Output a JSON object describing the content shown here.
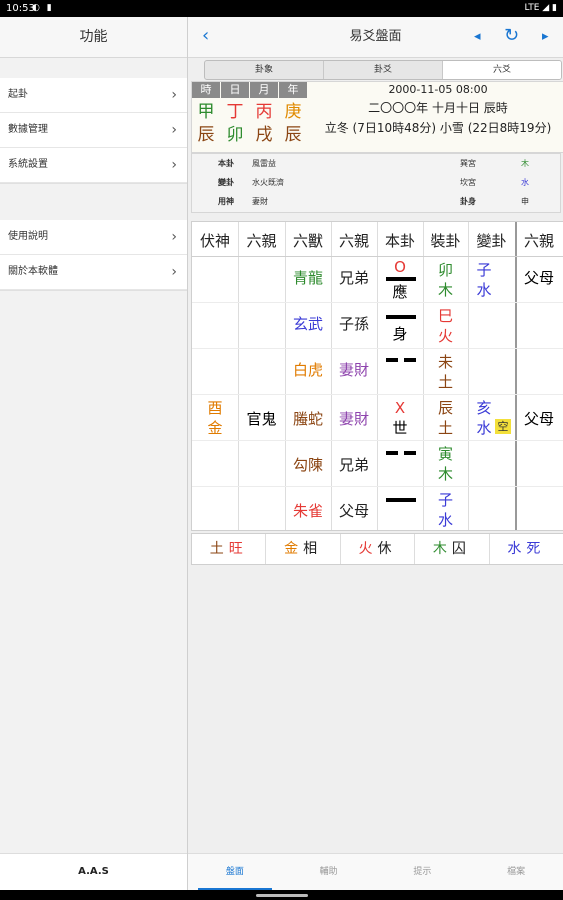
{
  "status": {
    "time": "10:53",
    "icons": "◐ ▮",
    "right": "LTE ◢ ▮"
  },
  "sidebar": {
    "title": "功能",
    "items": [
      {
        "label": "起卦"
      },
      {
        "label": "數據管理"
      },
      {
        "label": "系統設置"
      }
    ],
    "items2": [
      {
        "label": "使用說明"
      },
      {
        "label": "關於本軟體"
      }
    ],
    "footer": "A.A.S"
  },
  "nav": {
    "title": "易爻盤面",
    "back": "‹",
    "prev": "◂",
    "refresh": "↻",
    "next": "▸"
  },
  "segments": [
    {
      "label": "卦象"
    },
    {
      "label": "卦爻"
    },
    {
      "label": "六爻"
    }
  ],
  "date": {
    "pillar_headers": [
      "時",
      "日",
      "月",
      "年"
    ],
    "pillars": [
      {
        "stem": "甲",
        "branch": "辰",
        "stem_color": "#2e8b2e",
        "branch_color": "#8b4513"
      },
      {
        "stem": "丁",
        "branch": "卯",
        "stem_color": "#e53935",
        "branch_color": "#2e8b2e"
      },
      {
        "stem": "丙",
        "branch": "戌",
        "stem_color": "#e53935",
        "branch_color": "#8b4513"
      },
      {
        "stem": "庚",
        "branch": "辰",
        "stem_color": "#e08a00",
        "branch_color": "#8b4513"
      }
    ],
    "line1": "2000-11-05 08:00",
    "line2": "二〇〇〇年 十月十日 辰時",
    "line3": "立冬 (7日10時48分) 小雪 (22日8時19分)"
  },
  "gua": {
    "rows": [
      {
        "key": "本卦",
        "value": "風雷益",
        "palace": "巽宮",
        "element": "木",
        "element_color": "#2e8b2e"
      },
      {
        "key": "變卦",
        "value": "水火既濟",
        "palace": "坎宮",
        "element": "水",
        "element_color": "#3a3ad6"
      },
      {
        "key": "用神",
        "value": "妻財",
        "palace": "卦身",
        "element": "申",
        "element_color": "#333333"
      }
    ]
  },
  "table": {
    "headers": [
      "伏神",
      "六親",
      "六獸",
      "六親",
      "本卦",
      "裝卦",
      "變卦",
      "六親"
    ],
    "fushen": {
      "text1": "酉",
      "text2": "金",
      "color": "#e07b00"
    },
    "fushen_kin": "官鬼",
    "rows": [
      {
        "beast": "青龍",
        "beast_color": "#2e8b2e",
        "kin": "兄弟",
        "kin_color": "#222222",
        "mark": "O",
        "mark_color": "#e53935",
        "shiying": "應",
        "yao": "yang",
        "zh1": "卯",
        "zh2": "木",
        "zh_color": "#2e8b2e",
        "ch1": "子",
        "ch2": "水",
        "ch_color": "#3a3ad6",
        "ckin": "父母",
        "kong": ""
      },
      {
        "beast": "玄武",
        "beast_color": "#3a3ad6",
        "kin": "子孫",
        "kin_color": "#222222",
        "mark": "",
        "mark_color": "#222222",
        "shiying": "身",
        "yao": "yang",
        "zh1": "巳",
        "zh2": "火",
        "zh_color": "#e53935",
        "ch1": "",
        "ch2": "",
        "ch_color": "#222222",
        "ckin": "",
        "kong": ""
      },
      {
        "beast": "白虎",
        "beast_color": "#e07b00",
        "kin": "妻財",
        "kin_color": "#8e44ad",
        "mark": "",
        "mark_color": "#222222",
        "shiying": "",
        "yao": "yin",
        "zh1": "未",
        "zh2": "土",
        "zh_color": "#8b4513",
        "ch1": "",
        "ch2": "",
        "ch_color": "#222222",
        "ckin": "",
        "kong": ""
      },
      {
        "beast": "螣蛇",
        "beast_color": "#8b4513",
        "kin": "妻財",
        "kin_color": "#8e44ad",
        "mark": "X",
        "mark_color": "#e53935",
        "shiying": "世",
        "yao": "",
        "zh1": "辰",
        "zh2": "土",
        "zh_color": "#8b4513",
        "ch1": "亥",
        "ch2": "水",
        "ch_color": "#3a3ad6",
        "ckin": "父母",
        "kong": "空"
      },
      {
        "beast": "勾陳",
        "beast_color": "#8b4513",
        "kin": "兄弟",
        "kin_color": "#222222",
        "mark": "",
        "mark_color": "#222222",
        "shiying": "",
        "yao": "yin",
        "zh1": "寅",
        "zh2": "木",
        "zh_color": "#2e8b2e",
        "ch1": "",
        "ch2": "",
        "ch_color": "#222222",
        "ckin": "",
        "kong": ""
      },
      {
        "beast": "朱雀",
        "beast_color": "#e53935",
        "kin": "父母",
        "kin_color": "#222222",
        "mark": "",
        "mark_color": "#222222",
        "shiying": "",
        "yao": "yang",
        "zh1": "子",
        "zh2": "水",
        "zh_color": "#3a3ad6",
        "ch1": "",
        "ch2": "",
        "ch_color": "#222222",
        "ckin": "",
        "kong": ""
      }
    ]
  },
  "wuxing": [
    {
      "el": "土",
      "state": "旺",
      "el_color": "#8b4513",
      "state_color": "#e53935"
    },
    {
      "el": "金",
      "state": "相",
      "el_color": "#e07b00",
      "state_color": "#222222"
    },
    {
      "el": "火",
      "state": "休",
      "el_color": "#e53935",
      "state_color": "#222222"
    },
    {
      "el": "木",
      "state": "囚",
      "el_color": "#2e8b2e",
      "state_color": "#222222"
    },
    {
      "el": "水",
      "state": "死",
      "el_color": "#3a3ad6",
      "state_color": "#3a3ad6"
    }
  ],
  "tabs": [
    {
      "label": "盤面"
    },
    {
      "label": "輔助"
    },
    {
      "label": "提示"
    },
    {
      "label": "檔案"
    }
  ],
  "colors": {
    "accent": "#1976d2",
    "kong_bg": "#f3e03a"
  }
}
